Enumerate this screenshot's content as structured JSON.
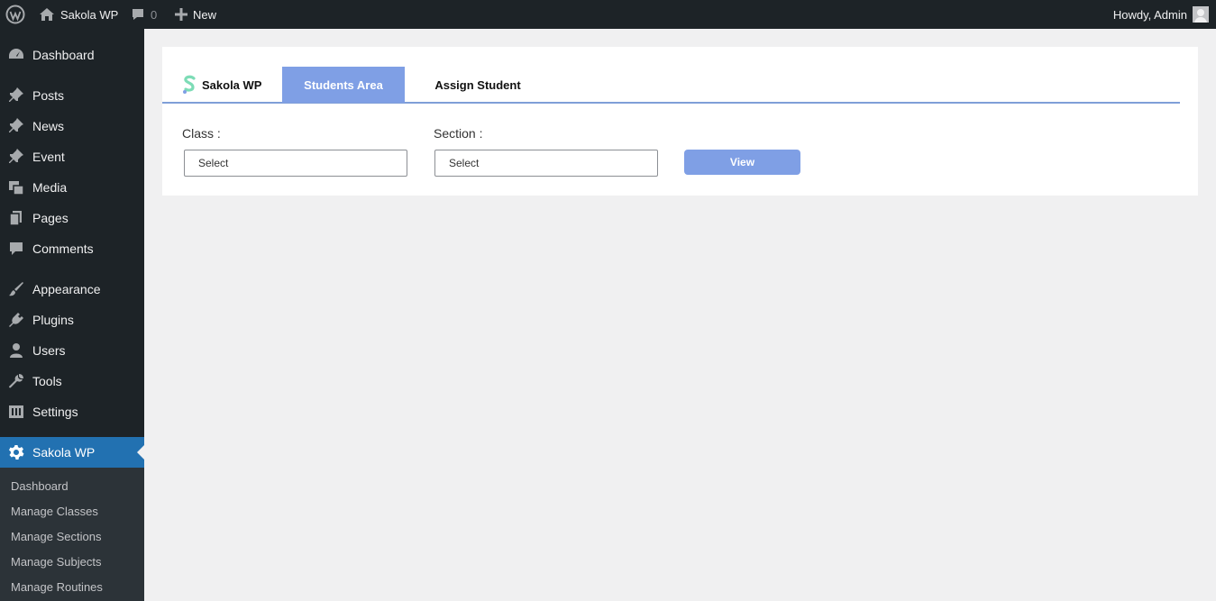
{
  "adminbar": {
    "site_name": "Sakola WP",
    "comments_count": "0",
    "new_label": "New",
    "howdy": "Howdy, Admin"
  },
  "sidebar": {
    "items": [
      {
        "label": "Dashboard",
        "icon": "dashboard-icon"
      },
      {
        "label": "Posts",
        "icon": "pin-icon"
      },
      {
        "label": "News",
        "icon": "pin-icon"
      },
      {
        "label": "Event",
        "icon": "pin-icon"
      },
      {
        "label": "Media",
        "icon": "media-icon"
      },
      {
        "label": "Pages",
        "icon": "pages-icon"
      },
      {
        "label": "Comments",
        "icon": "comment-icon"
      },
      {
        "label": "Appearance",
        "icon": "brush-icon"
      },
      {
        "label": "Plugins",
        "icon": "plug-icon"
      },
      {
        "label": "Users",
        "icon": "user-icon"
      },
      {
        "label": "Tools",
        "icon": "wrench-icon"
      },
      {
        "label": "Settings",
        "icon": "settings-icon"
      },
      {
        "label": "Sakola WP",
        "icon": "gear-icon"
      }
    ],
    "submenu": [
      "Dashboard",
      "Manage Classes",
      "Manage Sections",
      "Manage Subjects",
      "Manage Routines"
    ]
  },
  "main": {
    "brand": "Sakola WP",
    "tabs": [
      {
        "label": "Students Area",
        "active": true
      },
      {
        "label": "Assign Student",
        "active": false
      }
    ],
    "class_label": "Class :",
    "class_value": "Select",
    "section_label": "Section :",
    "section_value": "Select",
    "view_label": "View"
  },
  "colors": {
    "accent": "#7f9fe5",
    "admin_dark": "#1d2327",
    "current_menu": "#2271b1"
  }
}
